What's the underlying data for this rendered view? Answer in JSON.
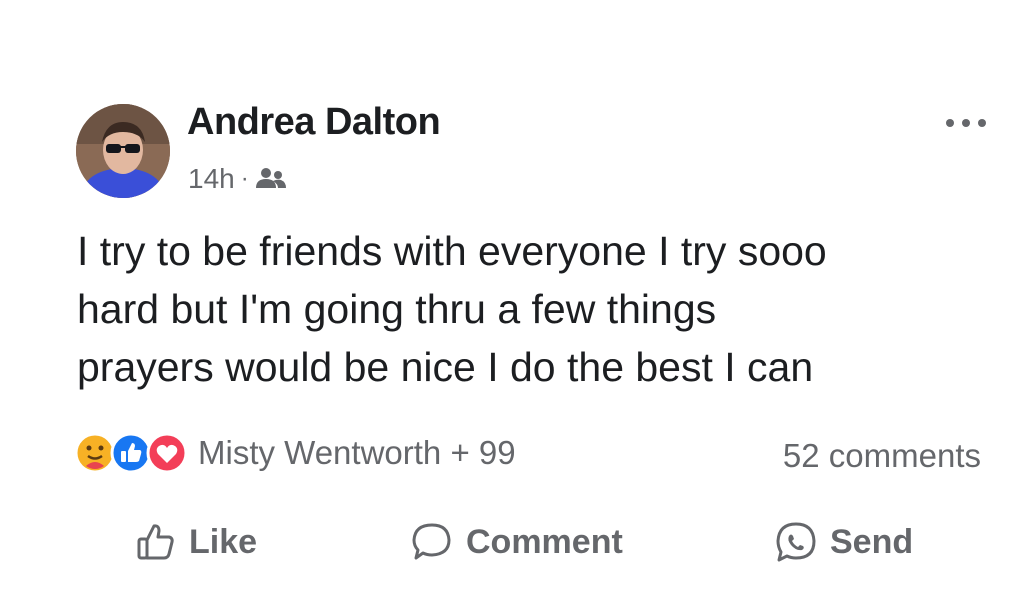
{
  "post": {
    "author": "Andrea Dalton",
    "time": "14h",
    "separator": "·",
    "audience_icon": "friends-icon",
    "more_icon": "more-options-icon",
    "text_lines": [
      "I try to be friends with everyone I try sooo",
      "hard but I'm going thru a few things",
      "prayers would be nice I do the best I can"
    ],
    "reactions": {
      "icons": [
        "care-reaction-icon",
        "like-reaction-icon",
        "love-reaction-icon"
      ],
      "summary": "Misty Wentworth + 99"
    },
    "comments_count": "52 comments",
    "actions": {
      "like": "Like",
      "comment": "Comment",
      "send": "Send"
    }
  },
  "colors": {
    "text_primary": "#1c1e21",
    "text_secondary": "#65676b",
    "like_blue": "#1877f2",
    "love_red": "#f33e58",
    "care_yellow": "#f7b125"
  }
}
